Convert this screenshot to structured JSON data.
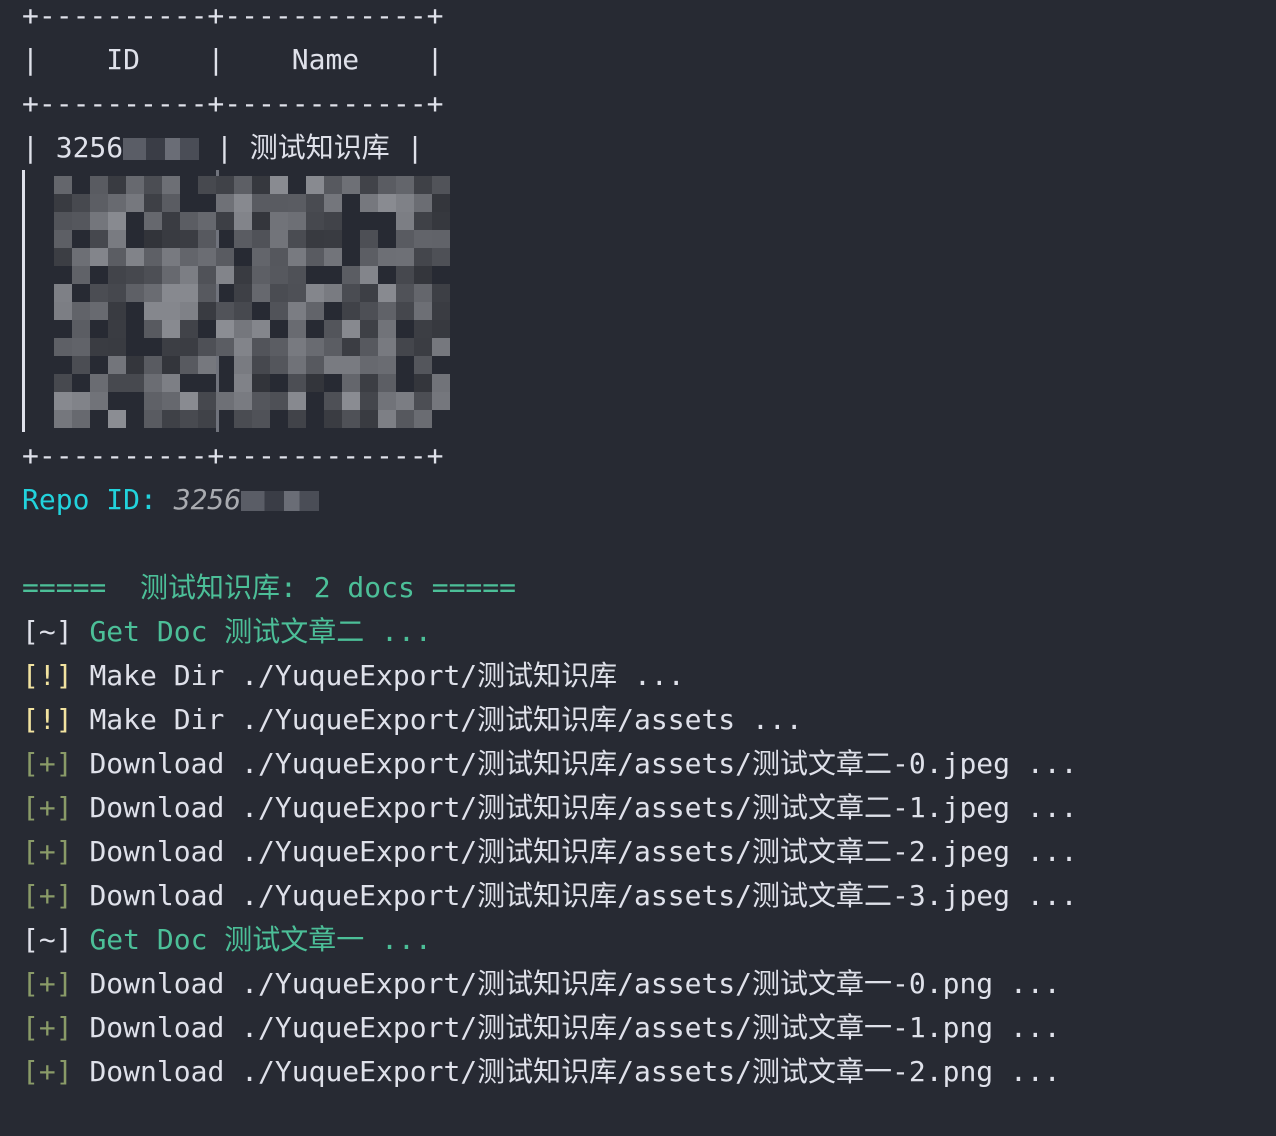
{
  "table": {
    "border": "+----------+------------+",
    "header_cells": [
      "ID",
      "Name"
    ],
    "rows": [
      {
        "id_visible": "3256",
        "name": "测试知识库"
      }
    ]
  },
  "repo": {
    "label": "Repo ID:",
    "value_visible": "3256"
  },
  "summary": "=====  测试知识库: 2 docs =====",
  "log": [
    {
      "tag": "[~]",
      "tag_color": "#dfe1ea",
      "text": "Get Doc 测试文章二 ...",
      "text_color": "#4cbf98"
    },
    {
      "tag": "[!]",
      "tag_color": "#f2e3a0",
      "text": "Make Dir ./YuqueExport/测试知识库 ...",
      "text_color": "#dfe1ea"
    },
    {
      "tag": "[!]",
      "tag_color": "#f2e3a0",
      "text": "Make Dir ./YuqueExport/测试知识库/assets ...",
      "text_color": "#dfe1ea"
    },
    {
      "tag": "[+]",
      "tag_color": "#8a9b68",
      "text": "Download ./YuqueExport/测试知识库/assets/测试文章二-0.jpeg ...",
      "text_color": "#dfe1ea"
    },
    {
      "tag": "[+]",
      "tag_color": "#8a9b68",
      "text": "Download ./YuqueExport/测试知识库/assets/测试文章二-1.jpeg ...",
      "text_color": "#dfe1ea"
    },
    {
      "tag": "[+]",
      "tag_color": "#8a9b68",
      "text": "Download ./YuqueExport/测试知识库/assets/测试文章二-2.jpeg ...",
      "text_color": "#dfe1ea"
    },
    {
      "tag": "[+]",
      "tag_color": "#8a9b68",
      "text": "Download ./YuqueExport/测试知识库/assets/测试文章二-3.jpeg ...",
      "text_color": "#dfe1ea"
    },
    {
      "tag": "[~]",
      "tag_color": "#dfe1ea",
      "text": "Get Doc 测试文章一 ...",
      "text_color": "#4cbf98"
    },
    {
      "tag": "[+]",
      "tag_color": "#8a9b68",
      "text": "Download ./YuqueExport/测试知识库/assets/测试文章一-0.png ...",
      "text_color": "#dfe1ea"
    },
    {
      "tag": "[+]",
      "tag_color": "#8a9b68",
      "text": "Download ./YuqueExport/测试知识库/assets/测试文章一-1.png ...",
      "text_color": "#dfe1ea"
    },
    {
      "tag": "[+]",
      "tag_color": "#8a9b68",
      "text": "Download ./YuqueExport/测试知识库/assets/测试文章一-2.png ...",
      "text_color": "#dfe1ea"
    }
  ],
  "colors": {
    "background": "#272a33",
    "cyan": "#22d3dc",
    "teal": "#4cbf98",
    "yellow": "#f2e3a0",
    "olive": "#8a9b68"
  }
}
